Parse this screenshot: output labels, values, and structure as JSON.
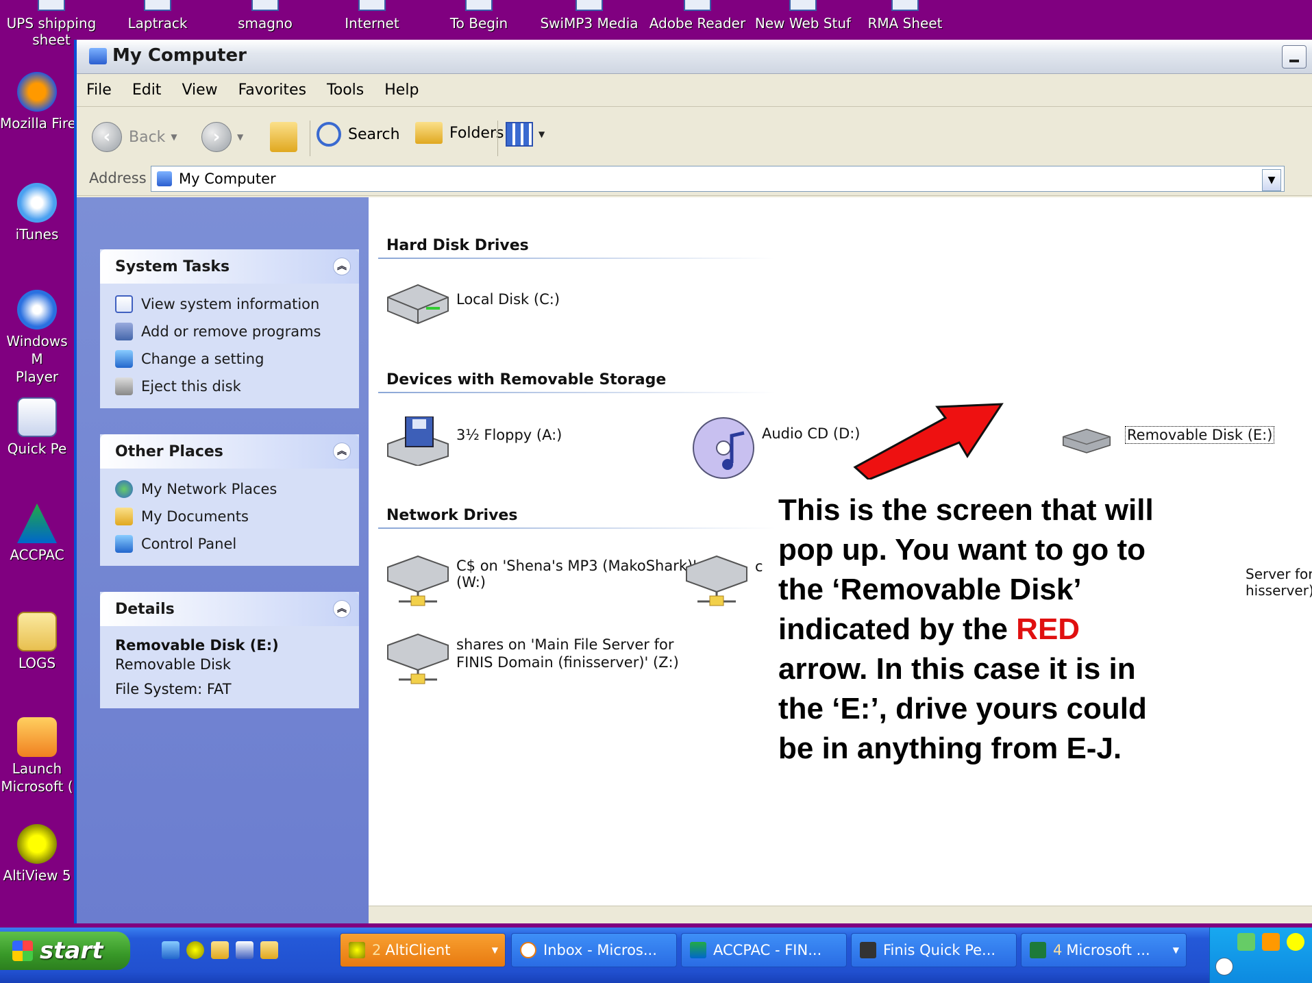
{
  "desktop": {
    "top_icons": [
      "UPS shipping\nsheet",
      "Laptrack",
      "smagno",
      "Internet",
      "To Begin",
      "SwiMP3 Media",
      "Adobe Reader",
      "New Web Stuf",
      "RMA Sheet"
    ],
    "left_icons": [
      "Mozilla Fire",
      "iTunes",
      "Windows M\nPlayer",
      "Quick Pe",
      "ACCPAC",
      "LOGS",
      "Launch\nMicrosoft (",
      "AltiView 5"
    ]
  },
  "window": {
    "title": "My Computer",
    "menu": [
      "File",
      "Edit",
      "View",
      "Favorites",
      "Tools",
      "Help"
    ],
    "toolbar": {
      "back": "Back",
      "search": "Search",
      "folders": "Folders"
    },
    "address": {
      "label": "Address",
      "value": "My Computer"
    }
  },
  "left_pane": {
    "system_tasks": {
      "title": "System Tasks",
      "items": [
        "View system information",
        "Add or remove programs",
        "Change a setting",
        "Eject this disk"
      ]
    },
    "other_places": {
      "title": "Other Places",
      "items": [
        "My Network Places",
        "My Documents",
        "Control Panel"
      ]
    },
    "details": {
      "title": "Details",
      "name": "Removable Disk (E:)",
      "type": "Removable Disk",
      "fs": "File System: FAT"
    }
  },
  "content": {
    "groups": {
      "hdd": "Hard Disk Drives",
      "removable": "Devices with Removable Storage",
      "network": "Network Drives"
    },
    "drives": {
      "c": "Local Disk (C:)",
      "a": "3½ Floppy (A:)",
      "d": "Audio CD (D:)",
      "e": "Removable Disk (E:)",
      "w1": "C$ on 'Shena's MP3 (MakoShark)'",
      "w2": "(W:)",
      "n2": "c",
      "y1": "Server for",
      "y2": "hisserver)' (Y:)",
      "z1": "shares on 'Main File Server for",
      "z2": "FINIS Domain (finisserver)' (Z:)"
    }
  },
  "callout": {
    "part1": "This is the screen that will pop up. You want to go to the ‘Removable Disk’ indicated by the ",
    "red": "RED",
    "part2": " arrow. In this case it is in the ‘E:’, drive yours could be in anything from E-J."
  },
  "taskbar": {
    "start": "start",
    "buttons": [
      {
        "count": "2",
        "label": "AltiClient"
      },
      {
        "label": "Inbox - Micros..."
      },
      {
        "label": "ACCPAC - FIN..."
      },
      {
        "label": "Finis Quick Pe..."
      },
      {
        "count": "4",
        "label": "Microsoft ..."
      }
    ]
  }
}
